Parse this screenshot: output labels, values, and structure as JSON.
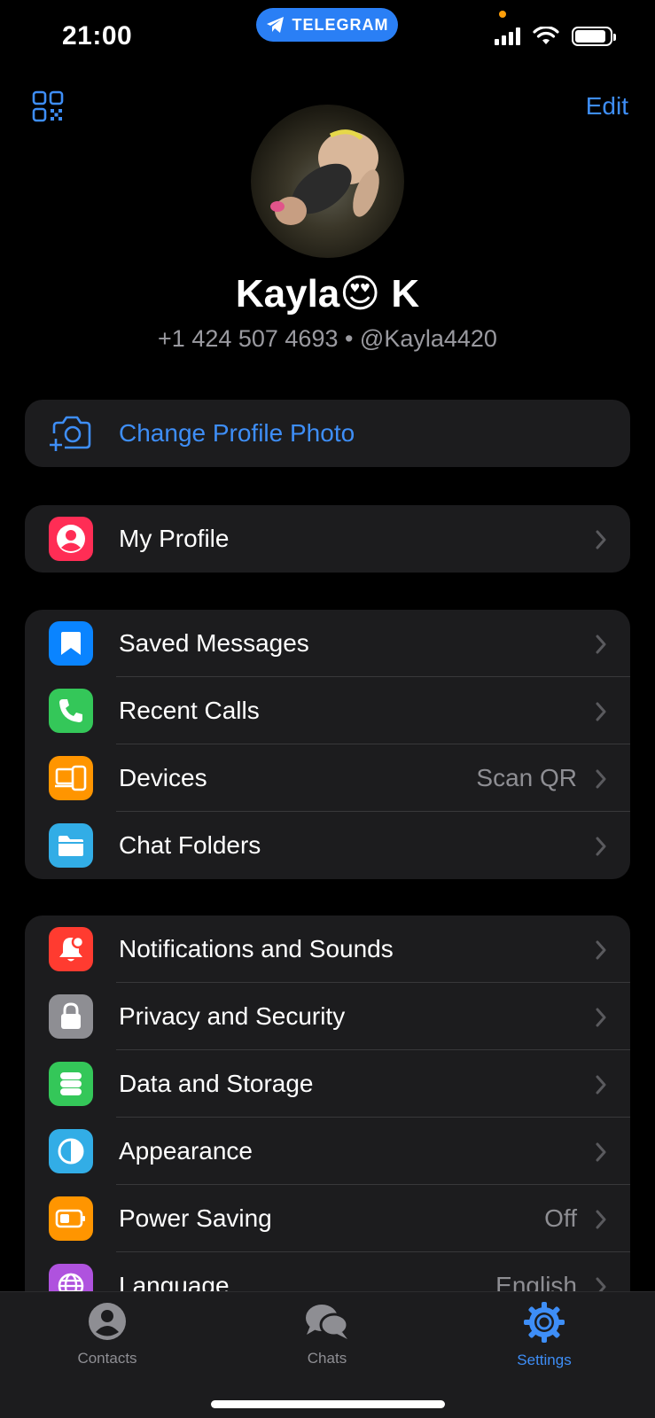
{
  "status": {
    "time": "21:00",
    "pill_label": "TELEGRAM",
    "battery_level": 0.9
  },
  "nav": {
    "qr_icon": "qr-code-icon",
    "edit_label": "Edit"
  },
  "profile": {
    "name": "Kayla😍 K",
    "subtitle": "+1 424 507 4693 • @Kayla4420"
  },
  "change_photo": {
    "label": "Change Profile Photo",
    "icon": "camera-add-icon"
  },
  "groups": {
    "profile": [
      {
        "label": "My Profile",
        "icon": "person-circle-icon",
        "color": "#ff2d55"
      }
    ],
    "main": [
      {
        "label": "Saved Messages",
        "icon": "bookmark-icon",
        "color": "#0a84ff"
      },
      {
        "label": "Recent Calls",
        "icon": "phone-icon",
        "color": "#34c759"
      },
      {
        "label": "Devices",
        "icon": "devices-icon",
        "color": "#ff9500",
        "value": "Scan QR"
      },
      {
        "label": "Chat Folders",
        "icon": "folder-icon",
        "color": "#32ade6"
      }
    ],
    "settings": [
      {
        "label": "Notifications and Sounds",
        "icon": "bell-icon",
        "color": "#ff3b30"
      },
      {
        "label": "Privacy and Security",
        "icon": "lock-icon",
        "color": "#8e8e93"
      },
      {
        "label": "Data and Storage",
        "icon": "database-icon",
        "color": "#34c759"
      },
      {
        "label": "Appearance",
        "icon": "half-circle-icon",
        "color": "#32ade6"
      },
      {
        "label": "Power Saving",
        "icon": "battery-icon",
        "color": "#ff9500",
        "value": "Off"
      },
      {
        "label": "Language",
        "icon": "globe-icon",
        "color": "#af52de",
        "value": "English"
      }
    ]
  },
  "tabs": [
    {
      "label": "Contacts",
      "icon": "person-icon",
      "active": false
    },
    {
      "label": "Chats",
      "icon": "chat-bubbles-icon",
      "active": false
    },
    {
      "label": "Settings",
      "icon": "gear-icon",
      "active": true
    }
  ],
  "colors": {
    "accent": "#3e8ef7",
    "background": "#000000",
    "cell": "#1c1c1e",
    "secondary_text": "#8e8e93"
  }
}
